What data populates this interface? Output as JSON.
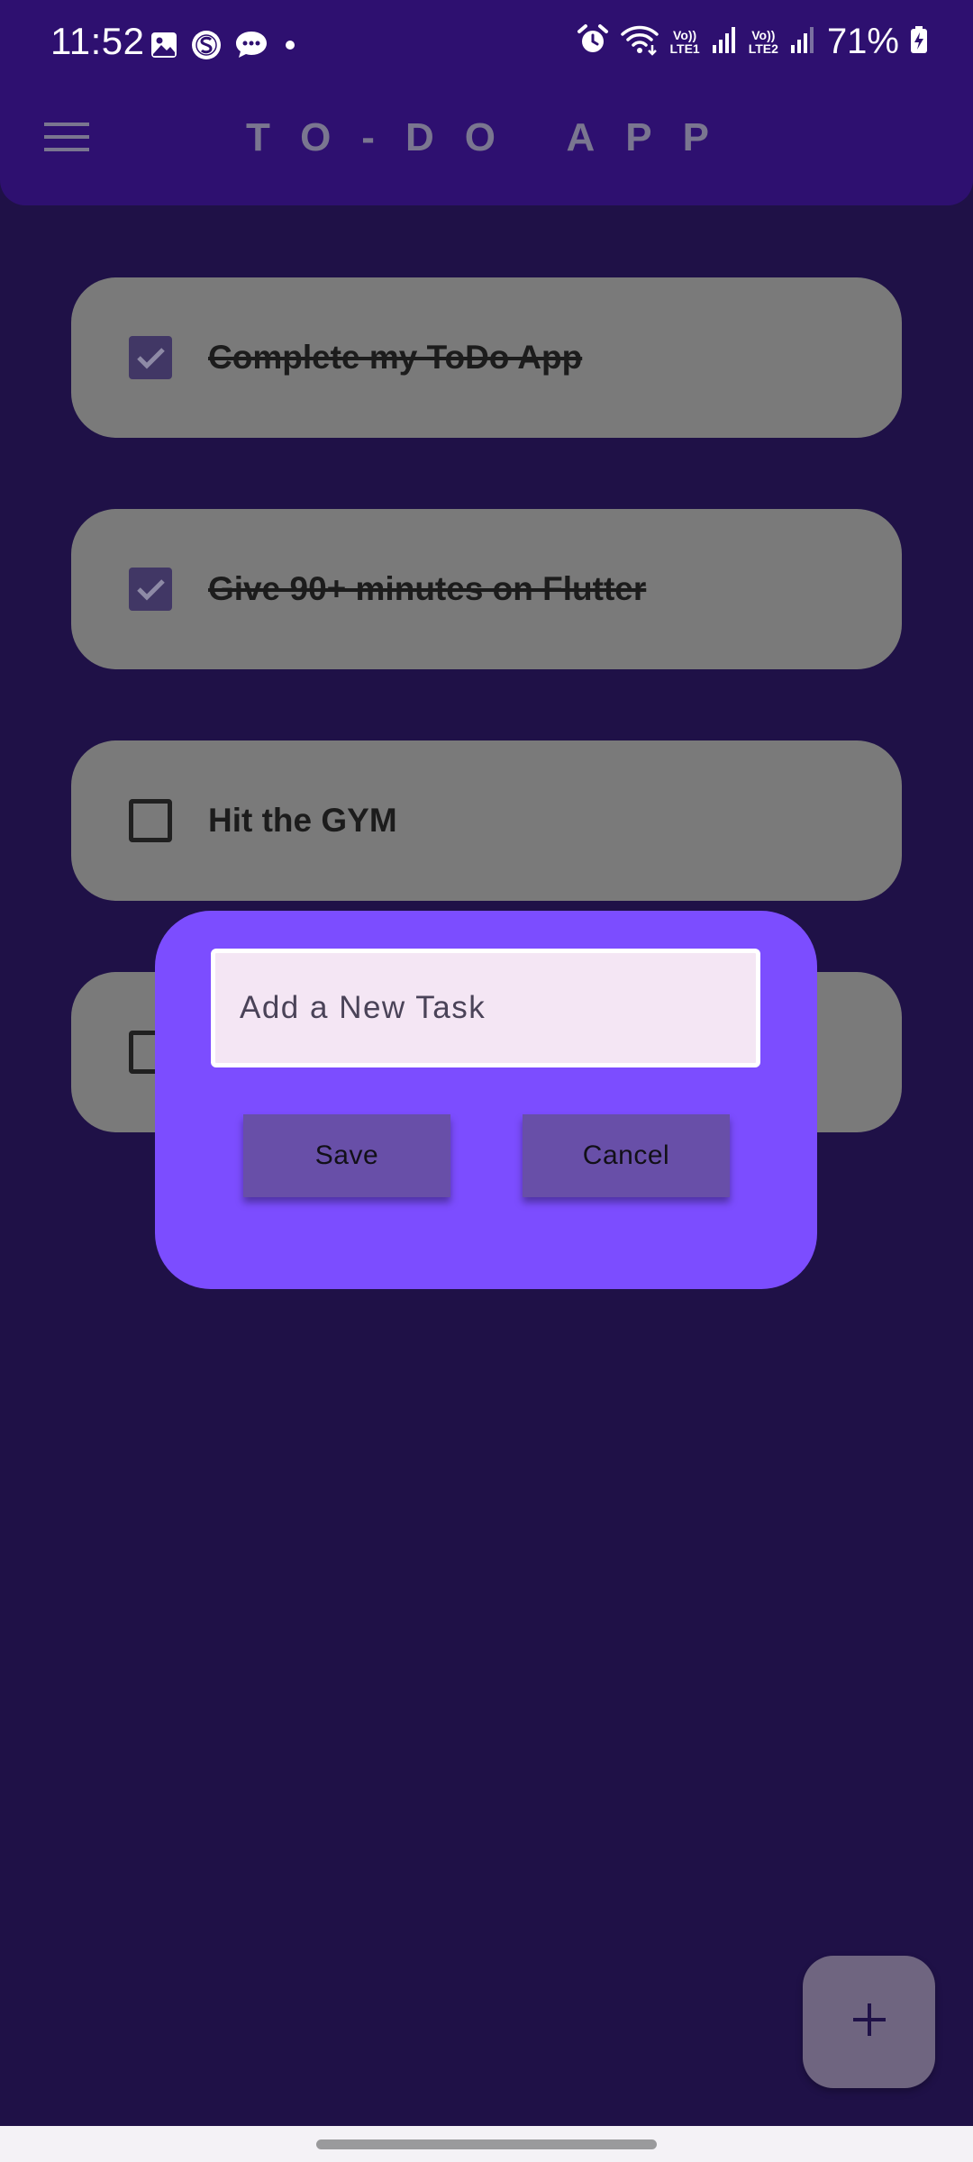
{
  "status_bar": {
    "time": "11:52",
    "battery": "71%",
    "sim1_label": "Vo)) LTE1",
    "sim2_label": "Vo)) LTE2",
    "sim1_top": "Vo))",
    "sim1_bottom": "LTE1",
    "sim2_top": "Vo))",
    "sim2_bottom": "LTE2"
  },
  "app_bar": {
    "title": "TO-DO APP",
    "menu_icon": "hamburger-menu-icon",
    "background": "#2e1070"
  },
  "tasks": [
    {
      "label": "Complete my ToDo App",
      "completed": true
    },
    {
      "label": "Give 90+ minutes on Flutter",
      "completed": true
    },
    {
      "label": "Hit the GYM",
      "completed": false
    },
    {
      "label": "",
      "completed": false
    }
  ],
  "dialog": {
    "input_placeholder": "Add a New Task",
    "input_value": "",
    "save_label": "Save",
    "cancel_label": "Cancel",
    "background": "#7c4dff"
  },
  "fab": {
    "icon": "plus-icon"
  },
  "colors": {
    "page_background": "#1f1147",
    "card": "#7a7a7a",
    "checkbox_checked": "#413765",
    "button": "#684fa8",
    "input_background": "#f4e6f4"
  }
}
